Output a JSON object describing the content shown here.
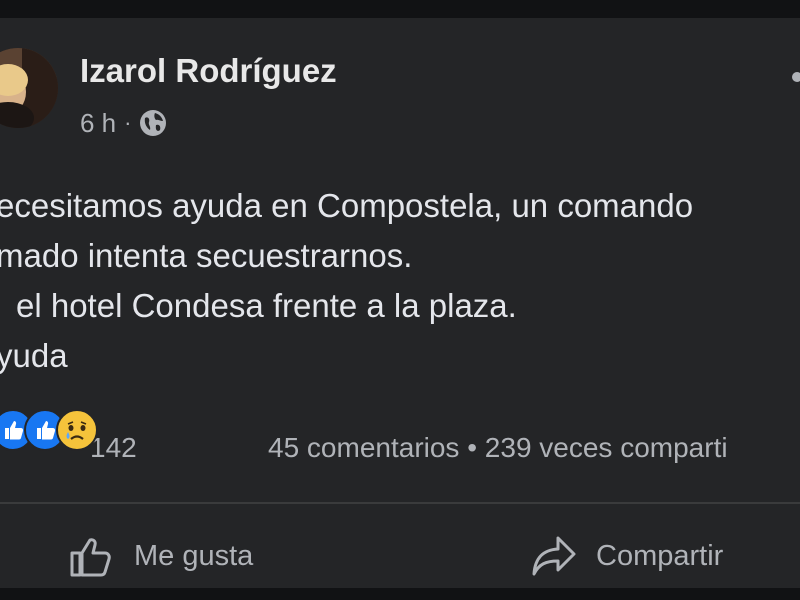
{
  "post": {
    "author_name": "Izarol Rodríguez",
    "timestamp": "6 h",
    "separator": "·",
    "audience_icon": "globe-icon",
    "lines": [
      "ecesitamos ayuda en Compostela, un comando",
      "mado intenta secuestrarnos.",
      "el hotel Condesa frente a la plaza.",
      "yuda"
    ]
  },
  "reactions": {
    "icons": [
      "like-reaction-icon",
      "like-reaction-icon",
      "sad-reaction-icon"
    ],
    "count": "142"
  },
  "stats": {
    "text": "45 comentarios • 239 veces comparti"
  },
  "actions": {
    "like_label": "Me gusta",
    "share_label": "Compartir"
  },
  "colors": {
    "background": "#242527",
    "text_primary": "#e4e6eb",
    "text_secondary": "#b0b3b8",
    "like_blue": "#1877f2",
    "sad_yellow": "#f5c33b"
  }
}
